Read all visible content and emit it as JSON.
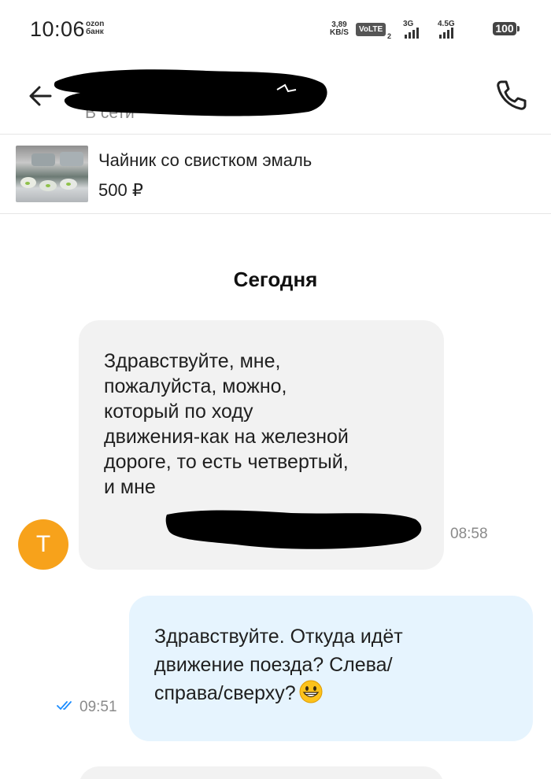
{
  "status_bar": {
    "time": "10:06",
    "brand_top": "ozon",
    "brand_bottom": "банк",
    "speed_value": "3,89",
    "speed_unit": "KB/S",
    "volte": "VoLTE",
    "volte_sim": "2",
    "network_1": "3G",
    "network_2": "4.5G",
    "battery": "100"
  },
  "header": {
    "contact_status": "В сети",
    "back_icon": "arrow-left-icon",
    "call_icon": "phone-icon"
  },
  "product": {
    "name": "Чайник со свистком эмаль",
    "price": "500 ₽"
  },
  "chat": {
    "date_separator": "Сегодня",
    "incoming": {
      "avatar_letter": "Т",
      "text": "Здравствуйте, мне,\nпожалуйста, можно,\nкоторый по ходу\nдвижения-как на железной\nдороге, то есть четвертый,\nи мне",
      "time": "08:58"
    },
    "outgoing": {
      "text": "Здравствуйте. Откуда идёт\nдвижение поезда? Слева/\nсправа/сверху?",
      "emoji": "grinning-face-emoji",
      "time": "09:51",
      "status_icon": "double-check-icon"
    }
  },
  "colors": {
    "avatar": "#f7a21b",
    "incoming_bubble": "#f2f2f2",
    "outgoing_bubble": "#e6f4fe",
    "read_ticks": "#1a8cff",
    "muted_text": "#8a8a8a"
  }
}
